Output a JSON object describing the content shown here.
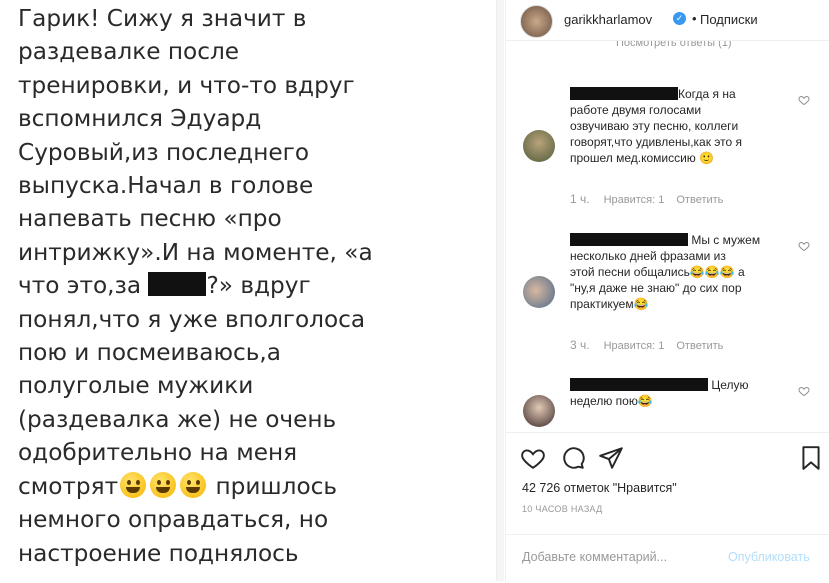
{
  "post_image": {
    "lines": [
      "Гарик! Сижу я значит в",
      "раздевалке после",
      "тренировки, и что-то вдруг",
      "вспомнился Эдуард",
      "Суровый,из последнего",
      "выпуска.Начал в голове",
      "напевать песню «про",
      "интрижку».И на моменте, «а",
      "что это,за",
      "?» вдруг",
      "понял,что я уже вполголоса",
      "пою и посмеиваюсь,а",
      "полуголые мужики",
      "(раздевалка же) не очень",
      "одобрительно на меня",
      "смотрят",
      "пришлось",
      "немного оправдаться, но",
      "настроение поднялось"
    ]
  },
  "header": {
    "username": "garikkharlamov",
    "separator": "•",
    "follow_label": "Подписки",
    "faded_text": "Посмотреть ответы (1)"
  },
  "comments": [
    {
      "text_lines": [
        "Когда я на",
        "работе двумя голосами",
        "озвучиваю эту песню, коллеги",
        "говорят,что удивлены,как это я",
        "прошел мед.комиссию 🙂"
      ],
      "time": "1 ч.",
      "likes": "Нравится: 1",
      "reply": "Ответить"
    },
    {
      "text_lines": [
        "Мы с мужем",
        "несколько дней фразами из",
        "этой песни общались😂😂😂 а",
        "\"ну,я даже не знаю\" до сих пор",
        "практикуем😂"
      ],
      "time": "3 ч.",
      "likes": "Нравится: 1",
      "reply": "Ответить"
    },
    {
      "text_lines": [
        "Целую",
        "неделю пою😂"
      ]
    }
  ],
  "footer": {
    "likes_text": "42 726 отметок \"Нравится\"",
    "time_ago": "10 ЧАСОВ НАЗАД",
    "comment_placeholder": "Добавьте комментарий...",
    "publish_label": "Опубликовать"
  },
  "colors": {
    "verified": "#3897f0",
    "publish_disabled": "#b2dffc",
    "muted": "#999999"
  },
  "icons": [
    "heart-icon",
    "comment-icon",
    "share-icon",
    "bookmark-icon",
    "verified-icon"
  ]
}
